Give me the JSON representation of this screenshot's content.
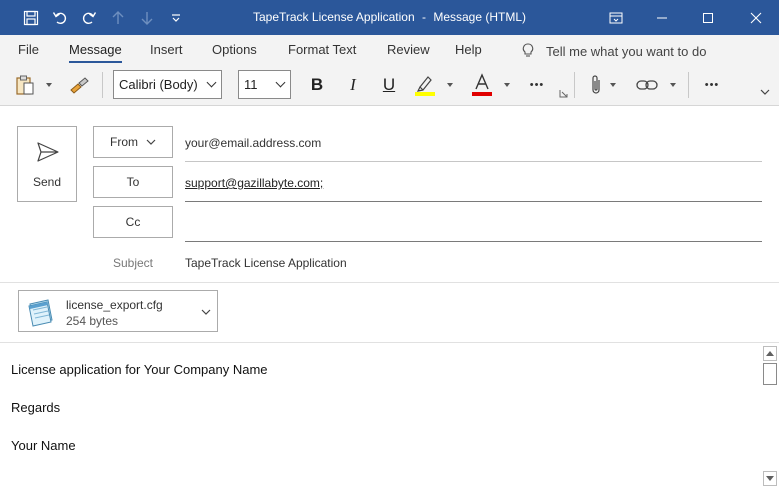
{
  "window": {
    "title_left": "TapeTrack License Application",
    "title_sep": "-",
    "title_right": "Message (HTML)"
  },
  "ribbon": {
    "tabs": [
      "File",
      "Message",
      "Insert",
      "Options",
      "Format Text",
      "Review",
      "Help"
    ],
    "active_tab": "Message",
    "tell_me": "Tell me what you want to do",
    "font_name": "Calibri (Body)",
    "font_size": "11",
    "bold": "B",
    "italic": "I",
    "underline": "U",
    "more": "•••",
    "highlight_color": "#ffff00",
    "font_color": "#e00000"
  },
  "compose": {
    "send_label": "Send",
    "from_label": "From",
    "from_value": "your@email.address.com",
    "to_label": "To",
    "to_value": "support@gazillabyte.com;",
    "cc_label": "Cc",
    "cc_value": "",
    "subject_label": "Subject",
    "subject_value": "TapeTrack License Application"
  },
  "attachment": {
    "name": "license_export.cfg",
    "size": "254 bytes",
    "icon": "notepad-file-icon"
  },
  "body": {
    "lines": [
      "License application for Your Company Name",
      "Regards",
      "Your Name"
    ]
  },
  "colors": {
    "titlebar": "#2b579a",
    "accent": "#2b579a"
  }
}
